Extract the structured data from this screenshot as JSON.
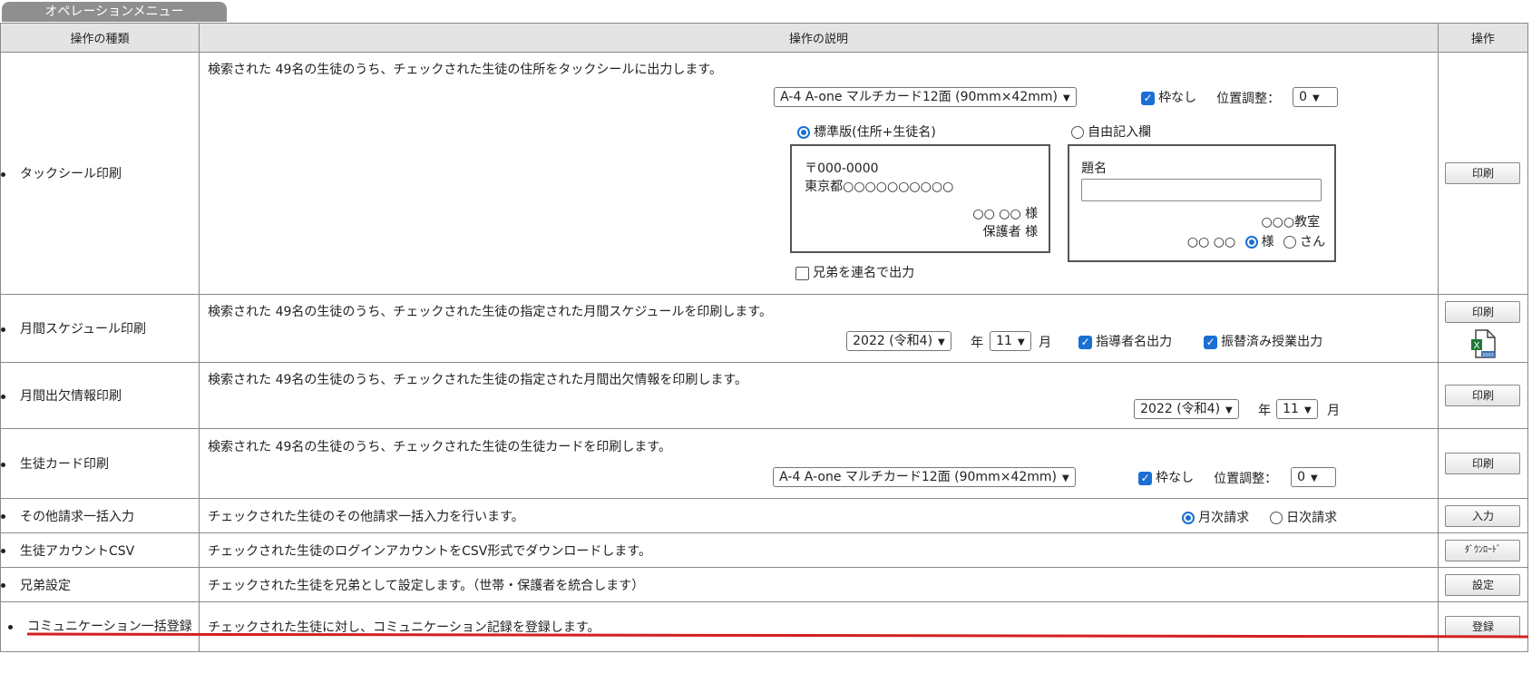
{
  "tab_label": "オペレーションメニュー",
  "headers": {
    "type": "操作の種類",
    "desc": "操作の説明",
    "action": "操作"
  },
  "rows": {
    "tack": {
      "name": "タックシール印刷",
      "desc": "検索された 49名の生徒のうち、チェックされた生徒の住所をタックシールに出力します。",
      "paper_select": "A-4 A-one マルチカード12面 (90mm×42mm)",
      "no_frame_label": "枠なし",
      "position_label": "位置調整：",
      "position_value": "0",
      "standard_label": "標準版(住所+生徒名)",
      "free_label": "自由記入欄",
      "sample_zip": "〒000-0000",
      "sample_addr": "東京都○○○○○○○○○○",
      "sample_name": "○○ ○○ 様",
      "sample_guardian": "保護者 様",
      "title_label": "題名",
      "title_value": "",
      "classroom": "○○○教室",
      "free_name": "○○ ○○",
      "honorific_sama": "様",
      "honorific_san": "さん",
      "siblings_label": "兄弟を連名で出力",
      "button": "印刷"
    },
    "schedule": {
      "name": "月間スケジュール印刷",
      "desc": "検索された 49名の生徒のうち、チェックされた生徒の指定された月間スケジュールを印刷します。",
      "year_select": "2022 (令和4)",
      "year_unit": "年",
      "month_select": "11",
      "month_unit": "月",
      "instructor_label": "指導者名出力",
      "transfer_label": "振替済み授業出力",
      "button": "印刷",
      "excel_badge": "2003"
    },
    "attendance": {
      "name": "月間出欠情報印刷",
      "desc": "検索された 49名の生徒のうち、チェックされた生徒の指定された月間出欠情報を印刷します。",
      "year_select": "2022 (令和4)",
      "year_unit": "年",
      "month_select": "11",
      "month_unit": "月",
      "button": "印刷"
    },
    "card": {
      "name": "生徒カード印刷",
      "desc": "検索された 49名の生徒のうち、チェックされた生徒の生徒カードを印刷します。",
      "paper_select": "A-4 A-one マルチカード12面 (90mm×42mm)",
      "no_frame_label": "枠なし",
      "position_label": "位置調整：",
      "position_value": "0",
      "button": "印刷"
    },
    "billing": {
      "name": "その他請求一括入力",
      "desc": "チェックされた生徒のその他請求一括入力を行います。",
      "monthly_label": "月次請求",
      "daily_label": "日次請求",
      "button": "入力"
    },
    "account": {
      "name": "生徒アカウントCSV",
      "desc": "チェックされた生徒のログインアカウントをCSV形式でダウンロードします。",
      "button": "ﾀﾞｳﾝﾛｰﾄﾞ"
    },
    "sibling": {
      "name": "兄弟設定",
      "desc": "チェックされた生徒を兄弟として設定します。（世帯・保護者を統合します）",
      "button": "設定"
    },
    "communication": {
      "name": "コミュニケーション一括登録",
      "desc": "チェックされた生徒に対し、コミュニケーション記録を登録します。",
      "button": "登録"
    }
  },
  "colors": {
    "highlight_line": "#d42020",
    "accent": "#1a6fd4"
  }
}
